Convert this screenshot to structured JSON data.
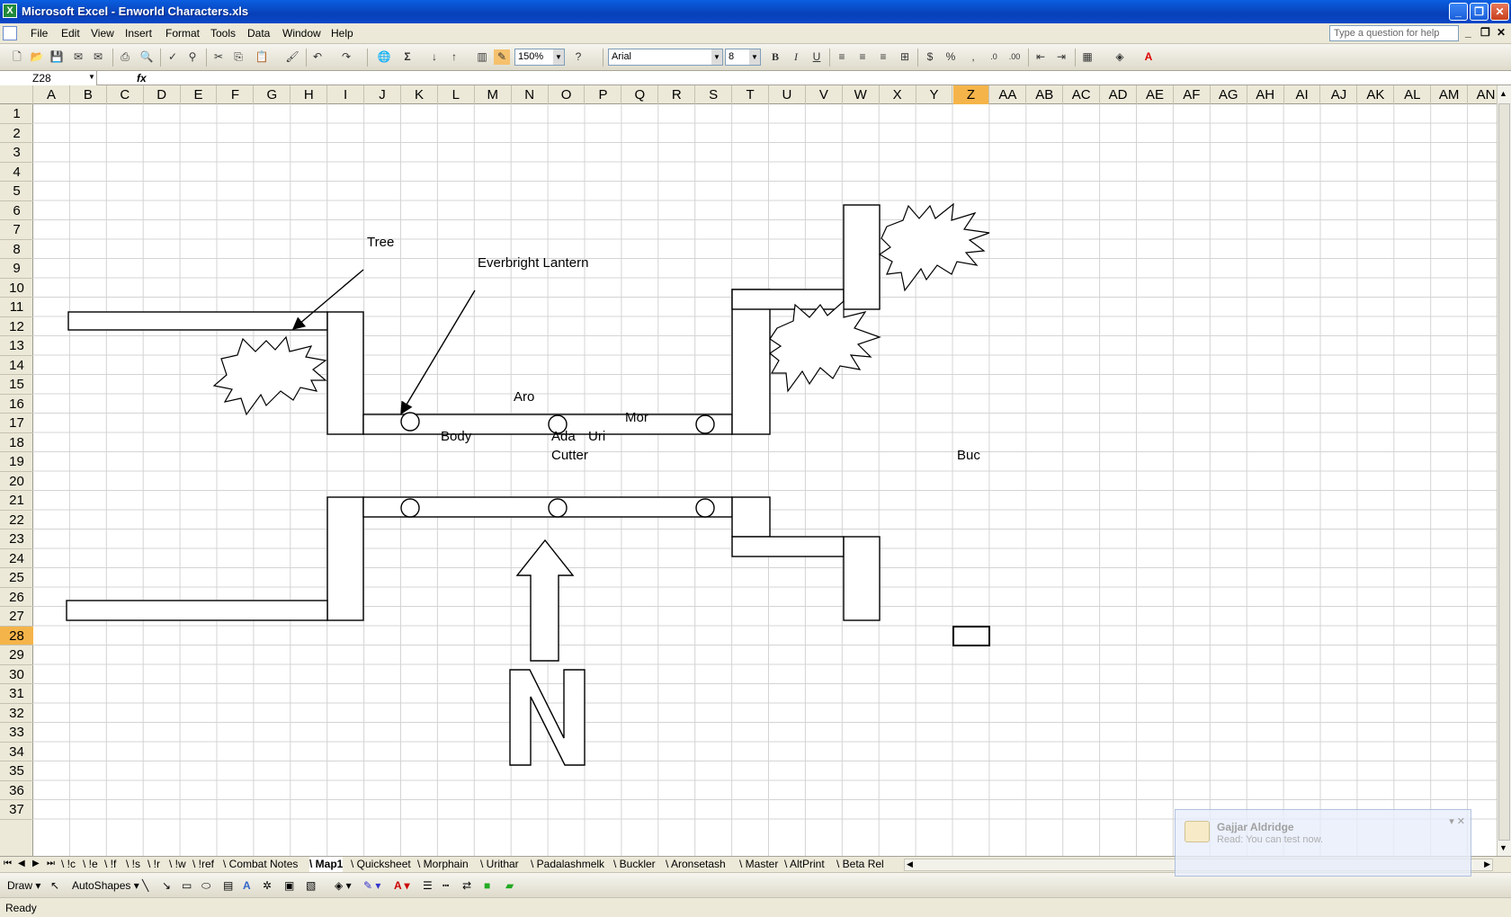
{
  "window": {
    "title": "Microsoft Excel - Enworld Characters.xls",
    "app_icon": "excel-icon",
    "buttons": {
      "minimize": "_",
      "restore": "❐",
      "close": "✕"
    }
  },
  "menu": {
    "items": [
      "File",
      "Edit",
      "View",
      "Insert",
      "Format",
      "Tools",
      "Data",
      "Window",
      "Help"
    ],
    "help_placeholder": "Type a question for help"
  },
  "toolbar": {
    "zoom": "150%",
    "font": "Arial",
    "font_size": "8",
    "bold": "B",
    "italic": "I",
    "underline": "U",
    "percent": "%",
    "comma": ",",
    "sum": "Σ"
  },
  "formula": {
    "cell": "Z28",
    "fx": "fx",
    "content": ""
  },
  "columns": [
    "A",
    "B",
    "C",
    "D",
    "E",
    "F",
    "G",
    "H",
    "I",
    "J",
    "K",
    "L",
    "M",
    "N",
    "O",
    "P",
    "Q",
    "R",
    "S",
    "T",
    "U",
    "V",
    "W",
    "X",
    "Y",
    "Z",
    "AA",
    "AB",
    "AC",
    "AD",
    "AE",
    "AF",
    "AG",
    "AH",
    "AI",
    "AJ",
    "AK",
    "AL",
    "AM",
    "AN"
  ],
  "rows": [
    "1",
    "2",
    "3",
    "4",
    "5",
    "6",
    "7",
    "8",
    "9",
    "10",
    "11",
    "12",
    "13",
    "14",
    "15",
    "16",
    "17",
    "18",
    "19",
    "20",
    "21",
    "22",
    "23",
    "24",
    "25",
    "26",
    "27",
    "28",
    "29",
    "30",
    "31",
    "32",
    "33",
    "34",
    "35",
    "36",
    "37"
  ],
  "selection": {
    "column": "Z",
    "row": "28"
  },
  "map_labels": {
    "tree": "Tree",
    "lantern": "Everbright Lantern",
    "aro": "Aro",
    "mor": "Mor",
    "body": "Body",
    "ada": "Ada",
    "uri": "Uri",
    "cutter": "Cutter",
    "buc": "Buc",
    "north": "N"
  },
  "sheet_tabs": [
    "!c",
    "!e",
    "!f",
    "!s",
    "!r",
    "!w",
    "!ref",
    "Combat Notes",
    "Map1",
    "Quicksheet",
    "Morphain",
    "Urithar",
    "Padalashmelk",
    "Buckler",
    "Aronsetash",
    "Master",
    "AltPrint",
    "Beta Rel"
  ],
  "active_tab": "Map1",
  "drawbar": {
    "draw": "Draw",
    "autoshapes": "AutoShapes"
  },
  "status": {
    "text": "Ready"
  },
  "notification": {
    "name": "Gajjar Aldridge",
    "message": "Read: You can test now."
  }
}
